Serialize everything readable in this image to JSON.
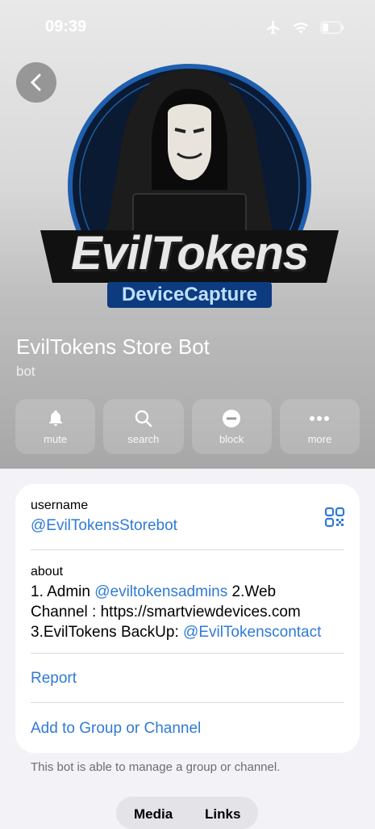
{
  "status": {
    "time": "09:39"
  },
  "profile": {
    "name": "EvilTokens Store Bot",
    "subtitle": "bot"
  },
  "logo": {
    "line1": "EvilTokens",
    "line2": "DeviceCapture"
  },
  "actions": [
    {
      "label": "mute",
      "icon": "bell-icon"
    },
    {
      "label": "search",
      "icon": "search-icon"
    },
    {
      "label": "block",
      "icon": "block-icon"
    },
    {
      "label": "more",
      "icon": "more-icon"
    }
  ],
  "info": {
    "username_label": "username",
    "username": "@EvilTokensStorebot",
    "about_label": "about",
    "about": {
      "line1_prefix": "1. Admin ",
      "admin_link": "@eviltokensadmins",
      "line1_suffix": " 2.Web",
      "line2": "Channel : https://smartviewdevices.com",
      "line3_prefix": "3.EvilTokens BackUp: ",
      "backup_link": "@EvilTokenscontact"
    },
    "report": "Report",
    "add_to_group": "Add to Group or Channel"
  },
  "footer_note": "This bot is able to manage a group or channel.",
  "tabs": [
    "Media",
    "Links"
  ]
}
